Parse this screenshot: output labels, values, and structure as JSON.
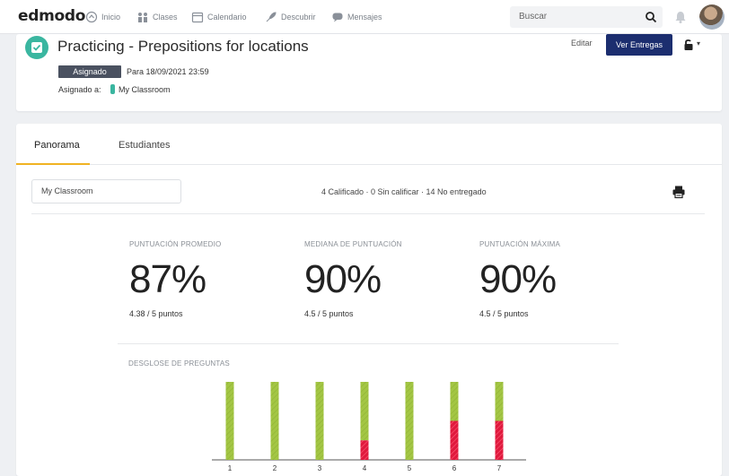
{
  "nav": {
    "logo": "edmodo",
    "items": [
      {
        "label": "Inicio",
        "icon": "home-icon"
      },
      {
        "label": "Clases",
        "icon": "classes-icon"
      },
      {
        "label": "Calendario",
        "icon": "calendar-icon"
      },
      {
        "label": "Descubrir",
        "icon": "rocket-icon"
      },
      {
        "label": "Mensajes",
        "icon": "chat-icon"
      }
    ],
    "search_placeholder": "Buscar"
  },
  "assignment": {
    "title": "Practicing - Prepositions for locations",
    "status": "Asignado",
    "due": "Para 18/09/2021 23:59",
    "assigned_to_label": "Asignado a:",
    "class_name": "My Classroom",
    "edit_label": "Editar",
    "view_button": "Ver Entregas"
  },
  "tabs": [
    {
      "label": "Panorama",
      "active": true
    },
    {
      "label": "Estudiantes",
      "active": false
    }
  ],
  "filter": {
    "class_selected": "My Classroom"
  },
  "summary": "4 Calificado · 0 Sin calificar · 14 No entregado",
  "stats": [
    {
      "label": "PUNTUACIÓN PROMEDIO",
      "value": "87%",
      "sub": "4.38 / 5 puntos"
    },
    {
      "label": "MEDIANA DE PUNTUACIÓN",
      "value": "90%",
      "sub": "4.5 / 5 puntos"
    },
    {
      "label": "PUNTUACIÓN MÁXIMA",
      "value": "90%",
      "sub": "4.5 / 5 puntos"
    }
  ],
  "breakdown_label": "DESGLOSE DE PREGUNTAS",
  "colors": {
    "correct": "#a3c644",
    "incorrect": "#e0193d",
    "brand": "#1c2e6f",
    "teal": "#3ab6a0",
    "tab_accent": "#f0b323"
  },
  "chart_data": {
    "type": "bar",
    "stacked": true,
    "categories": [
      "1",
      "2",
      "3",
      "4",
      "5",
      "6",
      "7"
    ],
    "series": [
      {
        "values": [
          4,
          4,
          4,
          3,
          4,
          2,
          2
        ]
      },
      {
        "values": [
          0,
          0,
          0,
          1,
          0,
          2,
          2
        ]
      }
    ],
    "ylim": [
      0,
      4
    ]
  }
}
